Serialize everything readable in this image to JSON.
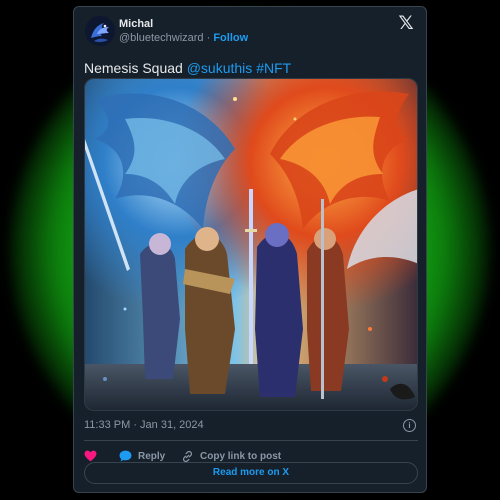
{
  "author": {
    "name": "Michal",
    "handle": "@bluetechwizard",
    "separator": " · ",
    "follow_label": "Follow",
    "avatar_icon": "blue-dragon-avatar"
  },
  "platform": {
    "logo_glyph": "𝕏",
    "logo_icon": "x-logo"
  },
  "tweet": {
    "text_plain": "Nemesis Squad ",
    "mention": "@sukuthis",
    "space": " ",
    "hashtag": "#NFT"
  },
  "media": {
    "subject": "four fantasy warriors standing before a blue winged eagle and a fiery phoenix"
  },
  "meta": {
    "timestamp": "11:33 PM · Jan 31, 2024",
    "info_glyph": "i"
  },
  "actions": {
    "like_label": "",
    "reply_label": "Reply",
    "copy_label": "Copy link to post"
  },
  "read_more_label": "Read more on X",
  "colors": {
    "card_bg": "#15202b",
    "accent": "#1d9bf0",
    "heart": "#f91880",
    "glow": "#19c719"
  }
}
